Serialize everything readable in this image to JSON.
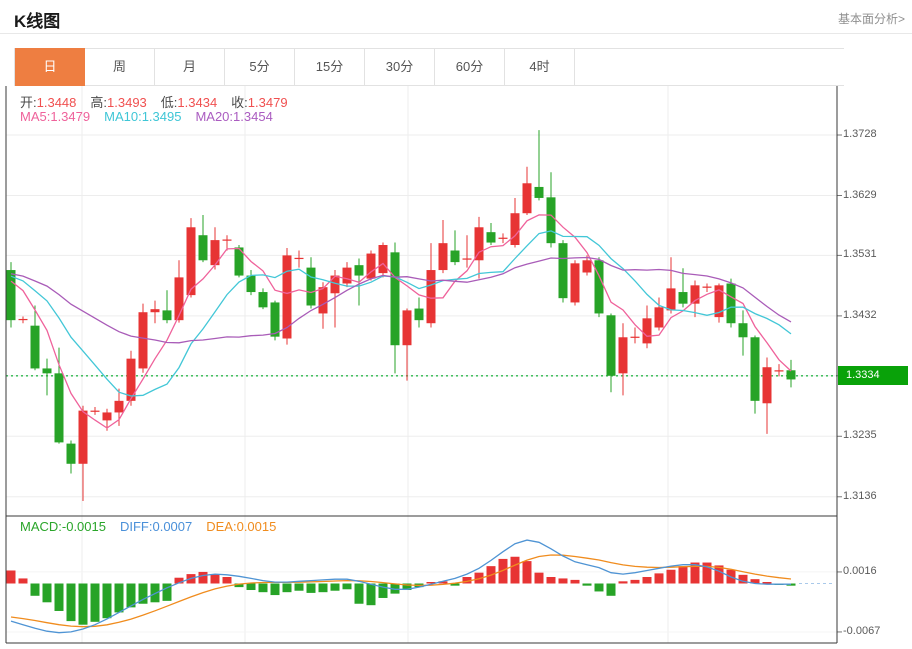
{
  "page": {
    "title": "K线图",
    "link_label": "基本面分析>"
  },
  "tabs": {
    "active_index": 0,
    "items": [
      "日",
      "周",
      "月",
      "5分",
      "15分",
      "30分",
      "60分",
      "4时"
    ]
  },
  "info_bar": {
    "ohlc": [
      {
        "label": "开:",
        "value": "1.3448"
      },
      {
        "label": "高:",
        "value": "1.3493"
      },
      {
        "label": "低:",
        "value": "1.3434"
      },
      {
        "label": "收:",
        "value": "1.3479"
      }
    ],
    "ma": [
      {
        "label": "MA5:",
        "value": "1.3479",
        "color": "#ef629b"
      },
      {
        "label": "MA10:",
        "value": "1.3495",
        "color": "#3fc6d6"
      },
      {
        "label": "MA20:",
        "value": "1.3454",
        "color": "#aa5cc0"
      }
    ]
  },
  "macd_bar": [
    {
      "label": "MACD:",
      "value": "-0.0015",
      "color": "#2aa52a"
    },
    {
      "label": "DIFF:",
      "value": "0.0007",
      "color": "#4a90d9"
    },
    {
      "label": "DEA:",
      "value": "0.0015",
      "color": "#f08c1e"
    }
  ],
  "axes": {
    "price_ticks": [
      "1.3728",
      "1.3629",
      "1.3531",
      "1.3432",
      "1.3334",
      "1.3235",
      "1.3136"
    ],
    "current_price": {
      "label": "1.3334",
      "value": 1.3334
    },
    "macd_ticks": [
      {
        "label": "0.0016",
        "value": 0.0016
      },
      {
        "label": "-0.0067",
        "value": -0.0067
      }
    ]
  },
  "colors": {
    "up": "#e73434",
    "down": "#27a327",
    "ma5": "#ef629b",
    "ma10": "#43c7d7",
    "ma20": "#a95cb8",
    "diff": "#4f94d4",
    "dea": "#f08c1e",
    "tag_bg": "#09a209",
    "dotted_line": "#2eb84d",
    "accent": "#ee7e41",
    "grid": "#ededed",
    "axis_line": "#3a3a3a",
    "dash_ext": "#a9c9ea"
  },
  "chart_data": {
    "type": "candlestick",
    "title": "K线图",
    "ylabel": "",
    "price_axis_range": [
      1.3136,
      1.3728
    ],
    "macd_axis_range": [
      -0.0082,
      0.006
    ],
    "x_gridlines": [
      82,
      245,
      408,
      668
    ],
    "ma_periods": [
      5,
      10,
      20
    ],
    "ma_prehistory": 1.3505,
    "candles": [
      [
        1.3507,
        1.352,
        1.3413,
        1.3425
      ],
      [
        1.3425,
        1.3431,
        1.342,
        1.3427
      ],
      [
        1.3416,
        1.3449,
        1.3343,
        1.3346
      ],
      [
        1.3346,
        1.3362,
        1.3302,
        1.3338
      ],
      [
        1.3338,
        1.338,
        1.3223,
        1.3225
      ],
      [
        1.3223,
        1.3228,
        1.3174,
        1.319
      ],
      [
        1.319,
        1.3285,
        1.3129,
        1.3277
      ],
      [
        1.3275,
        1.3283,
        1.327,
        1.3277
      ],
      [
        1.3261,
        1.328,
        1.3244,
        1.3274
      ],
      [
        1.3274,
        1.3313,
        1.3252,
        1.3293
      ],
      [
        1.3293,
        1.3375,
        1.3285,
        1.3362
      ],
      [
        1.3346,
        1.3452,
        1.3339,
        1.3438
      ],
      [
        1.3438,
        1.3457,
        1.342,
        1.3443
      ],
      [
        1.3441,
        1.3474,
        1.342,
        1.3425
      ],
      [
        1.3425,
        1.3523,
        1.3421,
        1.3495
      ],
      [
        1.3466,
        1.3592,
        1.3462,
        1.3577
      ],
      [
        1.3564,
        1.3597,
        1.352,
        1.3523
      ],
      [
        1.3515,
        1.3577,
        1.3508,
        1.3556
      ],
      [
        1.3555,
        1.3564,
        1.3539,
        1.3557
      ],
      [
        1.3544,
        1.3548,
        1.3495,
        1.3498
      ],
      [
        1.3498,
        1.3507,
        1.3466,
        1.3471
      ],
      [
        1.3471,
        1.3477,
        1.3443,
        1.3446
      ],
      [
        1.3454,
        1.3457,
        1.3392,
        1.3398
      ],
      [
        1.3395,
        1.3543,
        1.3385,
        1.3531
      ],
      [
        1.3525,
        1.3539,
        1.3511,
        1.3527
      ],
      [
        1.3511,
        1.3528,
        1.3444,
        1.3449
      ],
      [
        1.3436,
        1.3487,
        1.3411,
        1.3479
      ],
      [
        1.3469,
        1.3507,
        1.3413,
        1.3498
      ],
      [
        1.3485,
        1.352,
        1.3479,
        1.3511
      ],
      [
        1.3515,
        1.3526,
        1.3449,
        1.3498
      ],
      [
        1.3493,
        1.3539,
        1.349,
        1.3534
      ],
      [
        1.3502,
        1.3552,
        1.3495,
        1.3548
      ],
      [
        1.3536,
        1.3552,
        1.3338,
        1.3384
      ],
      [
        1.3384,
        1.3444,
        1.3326,
        1.3441
      ],
      [
        1.3444,
        1.3462,
        1.3413,
        1.3425
      ],
      [
        1.342,
        1.3551,
        1.3413,
        1.3507
      ],
      [
        1.3507,
        1.3589,
        1.3502,
        1.3551
      ],
      [
        1.3539,
        1.3572,
        1.3515,
        1.352
      ],
      [
        1.3524,
        1.3564,
        1.3511,
        1.3526
      ],
      [
        1.3523,
        1.3594,
        1.3493,
        1.3577
      ],
      [
        1.3569,
        1.3584,
        1.3548,
        1.3552
      ],
      [
        1.3558,
        1.3567,
        1.3551,
        1.356
      ],
      [
        1.3548,
        1.3625,
        1.3544,
        1.36
      ],
      [
        1.36,
        1.3676,
        1.3597,
        1.3649
      ],
      [
        1.3643,
        1.3736,
        1.3621,
        1.3625
      ],
      [
        1.3626,
        1.3667,
        1.3544,
        1.3551
      ],
      [
        1.3551,
        1.3556,
        1.3454,
        1.3461
      ],
      [
        1.3454,
        1.3523,
        1.3449,
        1.3518
      ],
      [
        1.3503,
        1.3531,
        1.3498,
        1.3523
      ],
      [
        1.3523,
        1.3528,
        1.343,
        1.3436
      ],
      [
        1.3433,
        1.3436,
        1.3307,
        1.3334
      ],
      [
        1.3338,
        1.342,
        1.3302,
        1.3397
      ],
      [
        1.3396,
        1.3413,
        1.3387,
        1.3398
      ],
      [
        1.3387,
        1.3449,
        1.3379,
        1.3428
      ],
      [
        1.3413,
        1.3462,
        1.3408,
        1.3446
      ],
      [
        1.3441,
        1.3528,
        1.3436,
        1.3477
      ],
      [
        1.3471,
        1.351,
        1.3446,
        1.3452
      ],
      [
        1.3452,
        1.349,
        1.343,
        1.3482
      ],
      [
        1.3478,
        1.3485,
        1.3471,
        1.348
      ],
      [
        1.343,
        1.3485,
        1.3421,
        1.3482
      ],
      [
        1.3485,
        1.3493,
        1.3413,
        1.342
      ],
      [
        1.342,
        1.3441,
        1.3367,
        1.3397
      ],
      [
        1.3397,
        1.34,
        1.3272,
        1.3293
      ],
      [
        1.3289,
        1.3364,
        1.3239,
        1.3348
      ],
      [
        1.3341,
        1.3353,
        1.3333,
        1.3343
      ],
      [
        1.3343,
        1.336,
        1.3315,
        1.3328
      ]
    ],
    "macd": {
      "hist": [
        0.0018,
        0.0007,
        -0.0017,
        -0.0026,
        -0.0038,
        -0.0052,
        -0.0057,
        -0.0053,
        -0.0048,
        -0.004,
        -0.0033,
        -0.0028,
        -0.0026,
        -0.0024,
        0.0008,
        0.0013,
        0.0016,
        0.0013,
        0.0009,
        -0.0005,
        -0.0009,
        -0.0012,
        -0.0016,
        -0.0012,
        -0.001,
        -0.0013,
        -0.0012,
        -0.001,
        -0.0008,
        -0.0028,
        -0.003,
        -0.002,
        -0.0014,
        -0.0009,
        -0.0005,
        0.0002,
        0.0003,
        -0.0003,
        0.0009,
        0.0015,
        0.0024,
        0.0034,
        0.0037,
        0.0031,
        0.0015,
        0.0009,
        0.0007,
        0.0005,
        -0.0003,
        -0.0011,
        -0.0017,
        0.0003,
        0.0005,
        0.0009,
        0.0014,
        0.0019,
        0.0024,
        0.0029,
        0.0029,
        0.0025,
        0.0019,
        0.0012,
        0.0006,
        0.0002,
        -0.0002,
        -0.0003
      ],
      "diff": [
        -0.0052,
        -0.0057,
        -0.0062,
        -0.0066,
        -0.0068,
        -0.0067,
        -0.0063,
        -0.0057,
        -0.0049,
        -0.004,
        -0.0031,
        -0.0022,
        -0.0014,
        -0.0006,
        0.0001,
        0.0007,
        0.0011,
        0.0013,
        0.0012,
        0.001,
        0.0007,
        0.0004,
        0.0002,
        0.0002,
        0.0003,
        0.0004,
        0.0005,
        0.0006,
        0.0006,
        0.0003,
        -0.0001,
        -0.0005,
        -0.0008,
        -0.0008,
        -0.0005,
        -0.0001,
        0.0003,
        0.0007,
        0.0013,
        0.0021,
        0.0032,
        0.0044,
        0.0055,
        0.006,
        0.0057,
        0.0048,
        0.0038,
        0.003,
        0.0026,
        0.0022,
        0.0015,
        0.0013,
        0.0015,
        0.0018,
        0.0021,
        0.0024,
        0.0026,
        0.0026,
        0.0023,
        0.0017,
        0.0009,
        0.0003,
        0.0,
        -0.0001,
        -0.0001,
        -0.0001
      ]
    }
  }
}
